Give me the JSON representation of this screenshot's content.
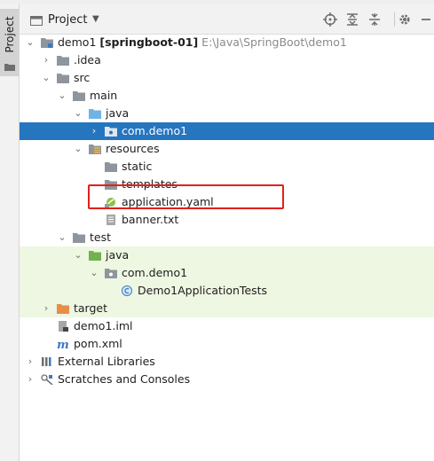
{
  "side_strip": {
    "label": "Project"
  },
  "header": {
    "title": "Project"
  },
  "tree": {
    "root": {
      "name": "demo1",
      "module": "[springboot-01]",
      "path": "E:\\Java\\SpringBoot\\demo1"
    },
    "idea": ".idea",
    "src": "src",
    "main": "main",
    "main_java": "java",
    "com_demo1_main": "com.demo1",
    "resources": "resources",
    "static": "static",
    "templates": "templates",
    "application_yaml": "application.yaml",
    "banner": "banner.txt",
    "test": "test",
    "test_java": "java",
    "com_demo1_test": "com.demo1",
    "test_class": "Demo1ApplicationTests",
    "target": "target",
    "iml": "demo1.iml",
    "pom": "pom.xml",
    "external_libraries": "External Libraries",
    "scratches": "Scratches and Consoles"
  },
  "colors": {
    "selection": "#2675bf",
    "test_background": "#eef7e2",
    "highlight_box": "#e0201c",
    "folder": "#8e959c",
    "source_folder": "#6fb4e5",
    "test_folder": "#73b14f",
    "excluded_folder": "#e68e4a"
  },
  "icons": [
    "project-folder-icon",
    "locate-icon",
    "expand-all-icon",
    "collapse-all-icon",
    "settings-gear-icon",
    "hide-minus-icon"
  ]
}
